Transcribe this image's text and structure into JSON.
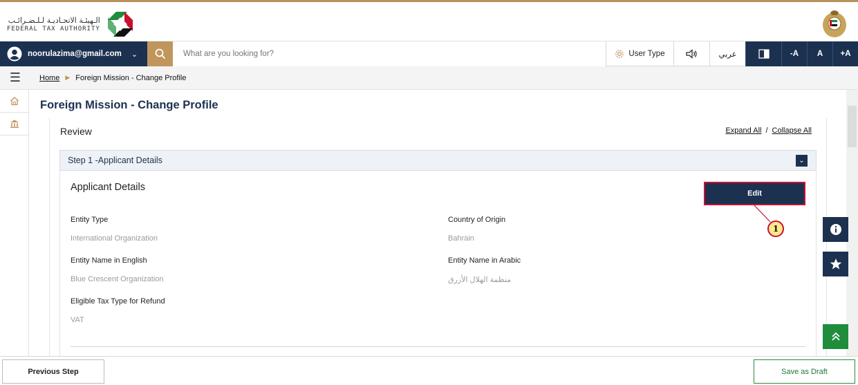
{
  "brand": {
    "arabic_name": "الـهيئـة الاتحـاديـة لـلـضـرائـب",
    "english_name": "FEDERAL TAX AUTHORITY"
  },
  "toolbar": {
    "user_email": "noorulazima@gmail.com",
    "search_placeholder": "What are you looking for?",
    "user_type_label": "User Type",
    "language_label": "عربي",
    "font_decrease": "-A",
    "font_normal": "A",
    "font_increase": "+A"
  },
  "breadcrumb": {
    "home": "Home",
    "current": "Foreign Mission - Change Profile"
  },
  "page": {
    "title": "Foreign Mission - Change Profile",
    "review_title": "Review",
    "expand_all": "Expand All",
    "separator": "/",
    "collapse_all": "Collapse All"
  },
  "step": {
    "header": "Step 1 -Applicant Details",
    "section_title": "Applicant Details",
    "edit_label": "Edit",
    "callout_number": "1",
    "fields": {
      "entity_type": {
        "label": "Entity Type",
        "value": "International Organization"
      },
      "country_of_origin": {
        "label": "Country of Origin",
        "value": "Bahrain"
      },
      "entity_name_en": {
        "label": "Entity Name in English",
        "value": "Blue Crescent Organization"
      },
      "entity_name_ar": {
        "label": "Entity Name in Arabic",
        "value": "منظمة الهلال الأزرق"
      },
      "eligible_tax_type": {
        "label": "Eligible Tax Type for Refund",
        "value": "VAT"
      }
    }
  },
  "footer": {
    "previous_label": "Previous Step",
    "save_draft_label": "Save as Draft"
  },
  "colors": {
    "navy": "#1c3150",
    "gold": "#c0965d",
    "green": "#1f8d3c",
    "highlight_red": "#c8102e"
  }
}
